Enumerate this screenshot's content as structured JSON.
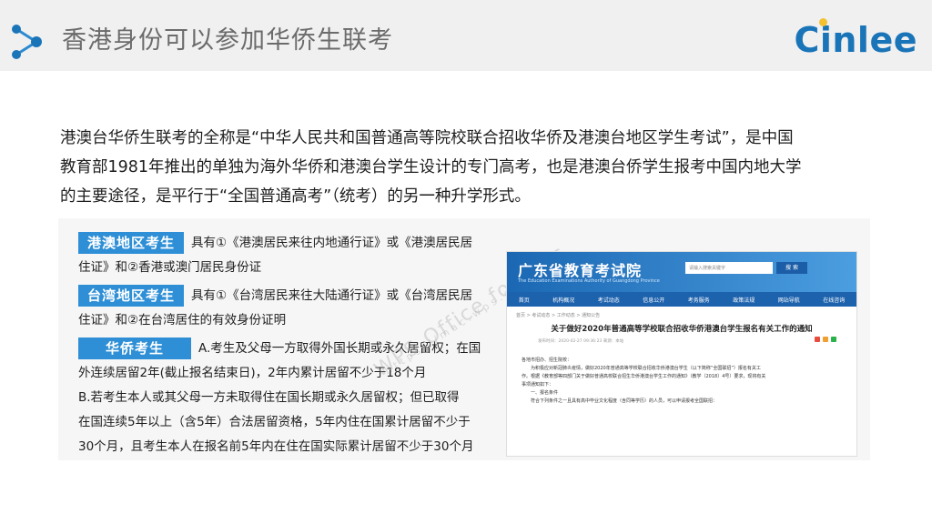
{
  "header": {
    "title": "香港身份可以参加华侨生联考",
    "logo": "Cinlee"
  },
  "intro": {
    "line1": "港澳台华侨生联考的全称是“中华人民共和国普通高等院校联合招收华侨及港澳台地区学生考试”，是中国",
    "line2": "教育部1981年推出的单独为海外华侨和港澳台学生设计的专门高考，也是港澳台侨学生报考中国内地大学",
    "line3": "的主要途径，是平行于“全国普通高考”（统考）的另一种升学形式。"
  },
  "panel": {
    "watermark": "WPS Office for Mac",
    "watermark_url": "https://mac.wps.cn/",
    "hk": {
      "tag": "港澳地区考生",
      "text1": "具有①《港澳居民来往内地通行证》或《港澳居民居",
      "text2": "住证》和②香港或澳门居民身份证"
    },
    "tw": {
      "tag": "台湾地区考生",
      "text1": "具有①《台湾居民来往大陆通行证》或《台湾居民居",
      "text2": "住证》和②在台湾居住的有效身份证明"
    },
    "oc": {
      "tag": "华侨考生",
      "text1": "A.考生及父母一方取得外国长期或永久居留权；在国",
      "text2": "外连续居留2年(截止报名结束日)，2年内累计居留不少于18个月",
      "text3": "B.若考生本人或其父母一方未取得住在国长期或永久居留权；但已取得",
      "text4": "在国连续5年以上（含5年）合法居留资格，5年内住在国累计居留不少于",
      "text5": "30个月，且考生本人在报名前5年内在住在国实际累计居留不少于30个月"
    }
  },
  "web": {
    "site_title": "广东省教育考试院",
    "site_sub": "The Education Examinations Authority of Guangdong Province",
    "search_placeholder": "请输入搜索关键字",
    "search_button": "搜 索",
    "nav": [
      "首页",
      "机构概况",
      "考试动态",
      "信息公开",
      "考务服务",
      "政策法规",
      "网站导航",
      "在线咨询"
    ],
    "breadcrumb": "首页 > 考试动态 > 工作动态 > 通知公告",
    "headline": "关于做好2020年普通高等学校联合招收华侨港澳台学生报名有关工作的通知",
    "meta": "发布时间：2020-02-27 09:36:23    来源：本站",
    "body1": "各地市招办、招生院校：",
    "body2": "为积极应对新冠肺炎疫情，做好2020年普通高等学校联合招收华侨港澳台学生（以下简称“全国联招”）报名有关工",
    "body3": "作。根据《教育部等四部门关于做好普通高校联合招生华侨港澳台学生工作的通知》（教学〔2018〕4号）要求，现将有关",
    "body4": "事项通知如下：",
    "body5": "一、报名条件",
    "body6": "符合下列条件之一且具有高中毕业文化程度（含同等学历）的人员，可以申请报考全国联招："
  }
}
